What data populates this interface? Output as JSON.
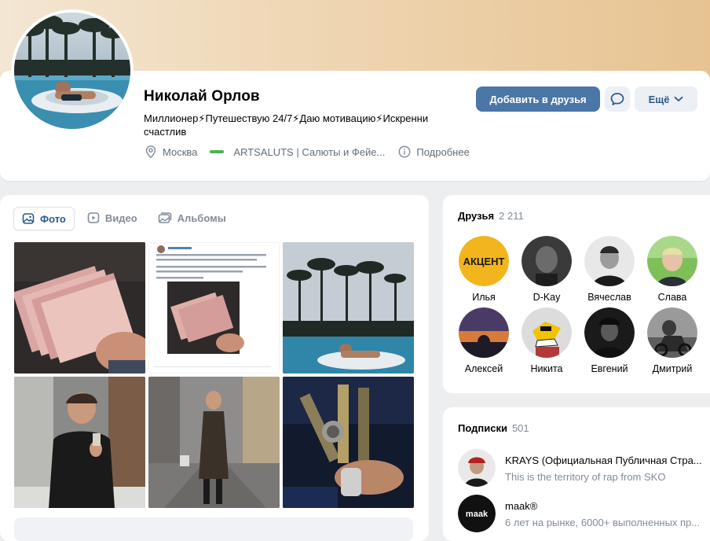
{
  "profile": {
    "name": "Николай Орлов",
    "status": "Миллионер⚡Путешествую 24/7⚡Даю мотивацию⚡Искренни счастлив",
    "city": "Москва",
    "work": "ARTSALUTS | Салюты и Фейе...",
    "work_logo_text": "ARTSALUTS",
    "more_info": "Подробнее"
  },
  "actions": {
    "add_friend": "Добавить в друзья",
    "more": "Ещё"
  },
  "photos": {
    "tabs": [
      {
        "label": "Фото",
        "active": true,
        "icon": "photo-icon"
      },
      {
        "label": "Видео",
        "active": false,
        "icon": "video-icon"
      },
      {
        "label": "Альбомы",
        "active": false,
        "icon": "albums-icon"
      }
    ],
    "items": [
      "money",
      "screenshot",
      "pool",
      "man-drink",
      "man-coat",
      "bottles"
    ]
  },
  "friends": {
    "title": "Друзья",
    "count": "2 211",
    "list": [
      {
        "name": "Илья"
      },
      {
        "name": "D-Kay"
      },
      {
        "name": "Вячеслав"
      },
      {
        "name": "Слава"
      },
      {
        "name": "Алексей"
      },
      {
        "name": "Никита"
      },
      {
        "name": "Евгений"
      },
      {
        "name": "Дмитрий"
      }
    ]
  },
  "subscriptions": {
    "title": "Подписки",
    "count": "501",
    "list": [
      {
        "title": "KRAYS (Официальная Публичная Стра...",
        "desc": "This is the territory of rap from SKO"
      },
      {
        "title": "maak®",
        "desc": "6 лет на рынке, 6000+ выполненных пр...",
        "logo_text": "maak"
      }
    ]
  },
  "colors": {
    "accent": "#4a76a8",
    "link": "#2c5a8a",
    "muted": "#818c99",
    "background": "#edeef0"
  }
}
